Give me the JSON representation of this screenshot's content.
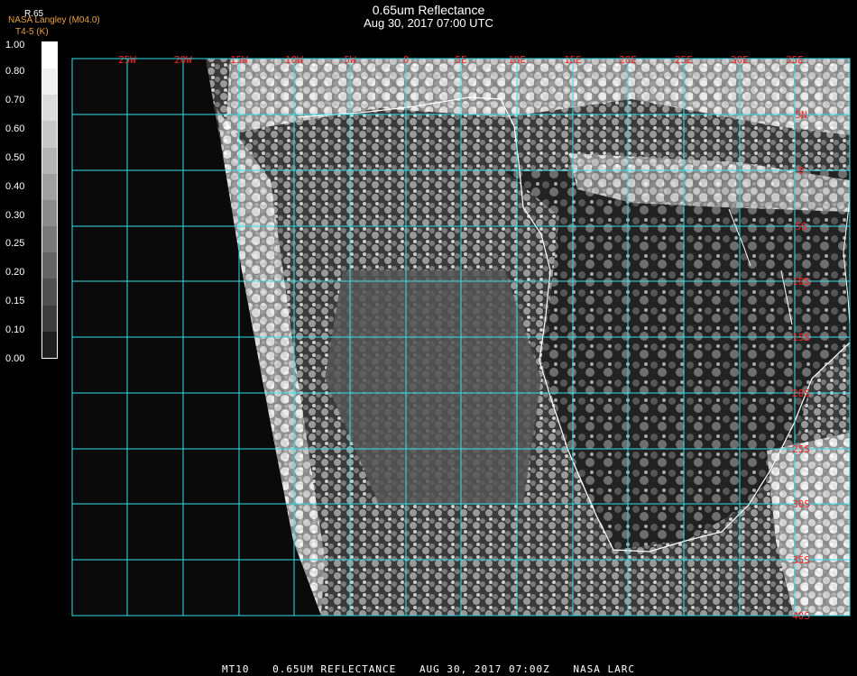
{
  "header": {
    "title": "0.65um Reflectance",
    "datetime": "Aug 30, 2017 07:00 UTC"
  },
  "source": {
    "agency": "NASA Langley (M04.0)",
    "channel": "T4-5 (K)"
  },
  "colorbar": {
    "top_label": "R.65",
    "labels": [
      "1.00",
      "0.80",
      "0.70",
      "0.60",
      "0.50",
      "0.40",
      "0.30",
      "0.25",
      "0.20",
      "0.15",
      "0.10",
      "0.00"
    ],
    "shades": [
      "#ffffff",
      "#f0f0f0",
      "#dcdcdc",
      "#c8c8c8",
      "#b4b4b4",
      "#a0a0a0",
      "#8c8c8c",
      "#787878",
      "#646464",
      "#505050",
      "#3c3c3c",
      "#1e1e1e"
    ]
  },
  "map": {
    "longitude_labels": [
      "25W",
      "20W",
      "15W",
      "10W",
      "5W",
      "0",
      "5E",
      "10E",
      "15E",
      "20E",
      "25E",
      "30E",
      "35E"
    ],
    "latitude_labels": [
      "5N",
      "0",
      "5S",
      "10S",
      "15S",
      "20S",
      "25S",
      "30S",
      "35S",
      "40S"
    ],
    "grid_color": "#33e0e8",
    "label_color": "#ff2020",
    "coast_color": "#ffffff"
  },
  "footer": {
    "satellite": "MT10",
    "product": "0.65UM REFLECTANCE",
    "date": "AUG 30, 2017 07:00Z",
    "producer": "NASA LARC"
  }
}
